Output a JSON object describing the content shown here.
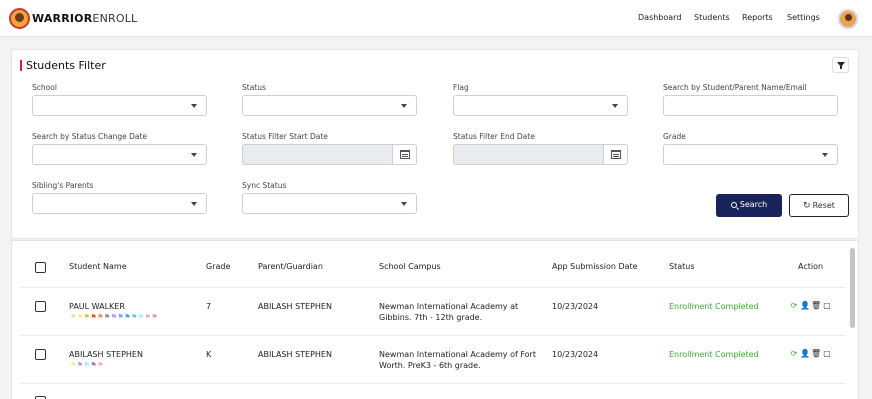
{
  "header": {
    "brand_bold": "WARRIOR",
    "brand_light": "ENROLL",
    "nav": [
      "Dashboard",
      "Students",
      "Reports",
      "Settings"
    ]
  },
  "filter": {
    "title": "Students Filter",
    "labels": {
      "school": "School",
      "status": "Status",
      "flag": "Flag",
      "search_name": "Search by Student/Parent Name/Email",
      "status_change_date": "Search by Status Change Date",
      "start_date": "Status Filter Start Date",
      "end_date": "Status Filter End Date",
      "grade": "Grade",
      "siblings": "Sibling's Parents",
      "sync": "Sync Status"
    },
    "search_label": "Search",
    "reset_label": "Reset"
  },
  "table": {
    "headers": [
      "Student Name",
      "Grade",
      "Parent/Guardian",
      "School Campus",
      "App Submission Date",
      "Status",
      "Action"
    ],
    "rows": [
      {
        "name": "PAUL WALKER",
        "grade": "7",
        "parent": "ABILASH STEPHEN",
        "campus": "Newman International Academy at Gibbins. 7th - 12th grade.",
        "date": "10/23/2024",
        "status": "Enrollment Completed",
        "flags": [
          "#c9f2a8",
          "#f7f08a",
          "#f5b342",
          "#f24b2a",
          "#f58a3a",
          "#8a8a8a",
          "#c58be6",
          "#6ea8f0",
          "#3fa0e8",
          "#5ec4f2",
          "#a8ecf5",
          "#f5a8c0",
          "#f08cb0"
        ]
      },
      {
        "name": "ABILASH STEPHEN",
        "grade": "K",
        "parent": "ABILASH STEPHEN",
        "campus": "Newman International Academy of Fort Worth. PreK3 - 6th grade.",
        "date": "10/23/2024",
        "status": "Enrollment Completed",
        "flags": [
          "#f7f08a",
          "#c58be6",
          "#a8ecf5",
          "#8a8a8a",
          "#f5a8c0"
        ]
      }
    ],
    "status_color": "#3aaa35"
  },
  "icons": {
    "sync": "sync-icon",
    "user": "user-icon",
    "delete": "trash-icon",
    "notes": "notes-icon"
  }
}
